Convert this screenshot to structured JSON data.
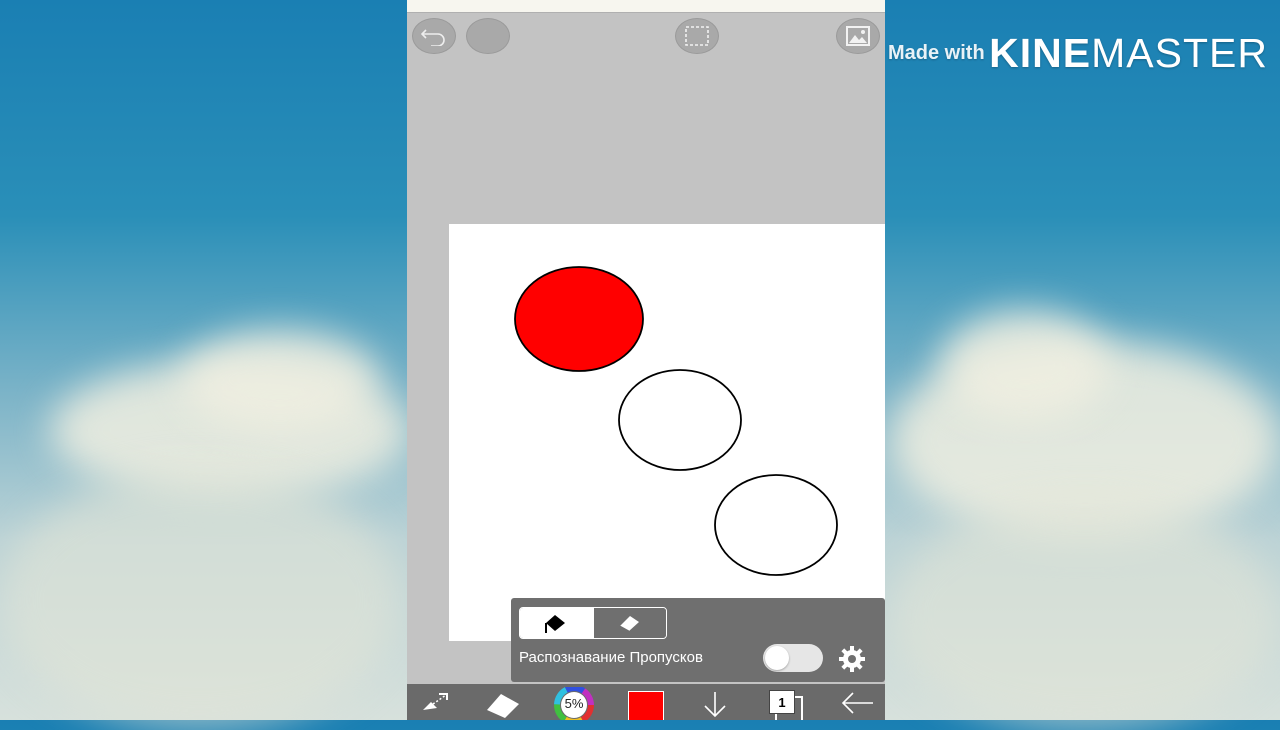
{
  "watermark": {
    "prefix": "Made with",
    "brand_bold": "KINE",
    "brand_light": "MASTER"
  },
  "canvas": {
    "background": "#ffffff",
    "fill_color": "#ff0000"
  },
  "toolbar_top": {
    "icons": [
      "undo-icon",
      "menu-icon",
      "selection-icon",
      "gallery-icon"
    ]
  },
  "fill_panel": {
    "modes": [
      "fill-bucket-icon",
      "eraser-icon"
    ],
    "active_mode": "fill",
    "gap_detection_label": "Распознавание Пропусков",
    "gap_detection_enabled": false
  },
  "bottom_bar": {
    "brush_size": "5%",
    "current_color": "#ff0000",
    "layer_count": "1"
  }
}
